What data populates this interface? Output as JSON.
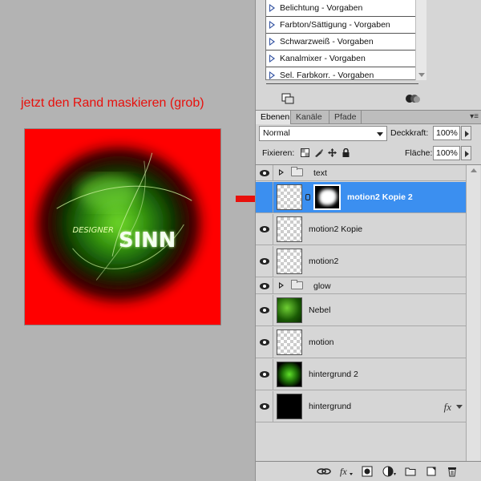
{
  "caption": "jetzt den Rand maskieren (grob)",
  "canvas": {
    "logo_small": "DESIGNER",
    "logo_big": "SINN"
  },
  "adjustments": {
    "items": [
      "Belichtung - Vorgaben",
      "Farbton/Sättigung - Vorgaben",
      "Schwarzweiß - Vorgaben",
      "Kanalmixer - Vorgaben",
      "Sel. Farbkorr. - Vorgaben"
    ]
  },
  "tabs": [
    {
      "label": "Ebenen",
      "active": true
    },
    {
      "label": "Kanäle",
      "active": false
    },
    {
      "label": "Pfade",
      "active": false
    }
  ],
  "panel_menu": "▾≡",
  "blend": {
    "mode": "Normal",
    "opacity_label": "Deckkraft:",
    "opacity_value": "100%"
  },
  "lock": {
    "label": "Fixieren:",
    "fill_label": "Fläche:",
    "fill_value": "100%"
  },
  "layers": [
    {
      "name": "text",
      "kind": "group"
    },
    {
      "name": "motion2 Kopie 2",
      "kind": "masked",
      "selected": true
    },
    {
      "name": "motion2 Kopie",
      "kind": "layer"
    },
    {
      "name": "motion2",
      "kind": "layer"
    },
    {
      "name": "glow",
      "kind": "group"
    },
    {
      "name": "Nebel",
      "kind": "nebel"
    },
    {
      "name": "motion",
      "kind": "layer"
    },
    {
      "name": "hintergrund 2",
      "kind": "hg2"
    },
    {
      "name": "hintergrund",
      "kind": "hg",
      "fx": "fx"
    }
  ],
  "bottom_icons": [
    "link-icon",
    "fx-icon",
    "mask-icon",
    "adjustment-icon",
    "folder-icon",
    "new-layer-icon",
    "trash-icon"
  ],
  "colors": {
    "caption": "#e8100c",
    "canvas_bg": "#ff0000",
    "selection": "#3b8ff0",
    "arrow": "#e8100c"
  }
}
